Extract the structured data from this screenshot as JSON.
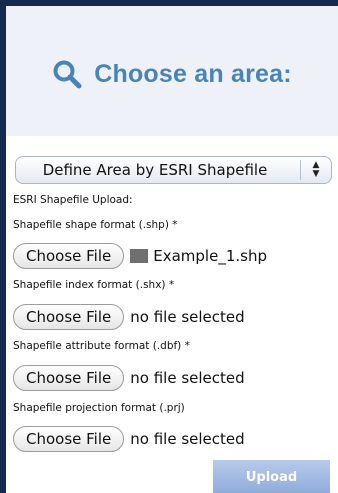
{
  "header": {
    "icon": "search-icon",
    "title": "Choose an area:"
  },
  "area_select": {
    "selected": "Define Area by ESRI Shapefile",
    "icon": "up-down-arrows-icon"
  },
  "upload_section": {
    "heading": "ESRI Shapefile Upload:",
    "choose_label": "Choose File",
    "fields": [
      {
        "label": "Shapefile shape format (.shp) *",
        "value": "Example_1.shp",
        "has_file_icon": true
      },
      {
        "label": "Shapefile index format (.shx) *",
        "value": "no file selected"
      },
      {
        "label": "Shapefile attribute format (.dbf) *",
        "value": "no file selected"
      },
      {
        "label": "Shapefile projection format (.prj)",
        "value": "no file selected"
      }
    ],
    "upload_label": "Upload"
  },
  "colors": {
    "border": "#16294f",
    "panel_bg": "#eef1f8",
    "title": "#4a83b8",
    "upload_bg": "#9fb8e3"
  }
}
